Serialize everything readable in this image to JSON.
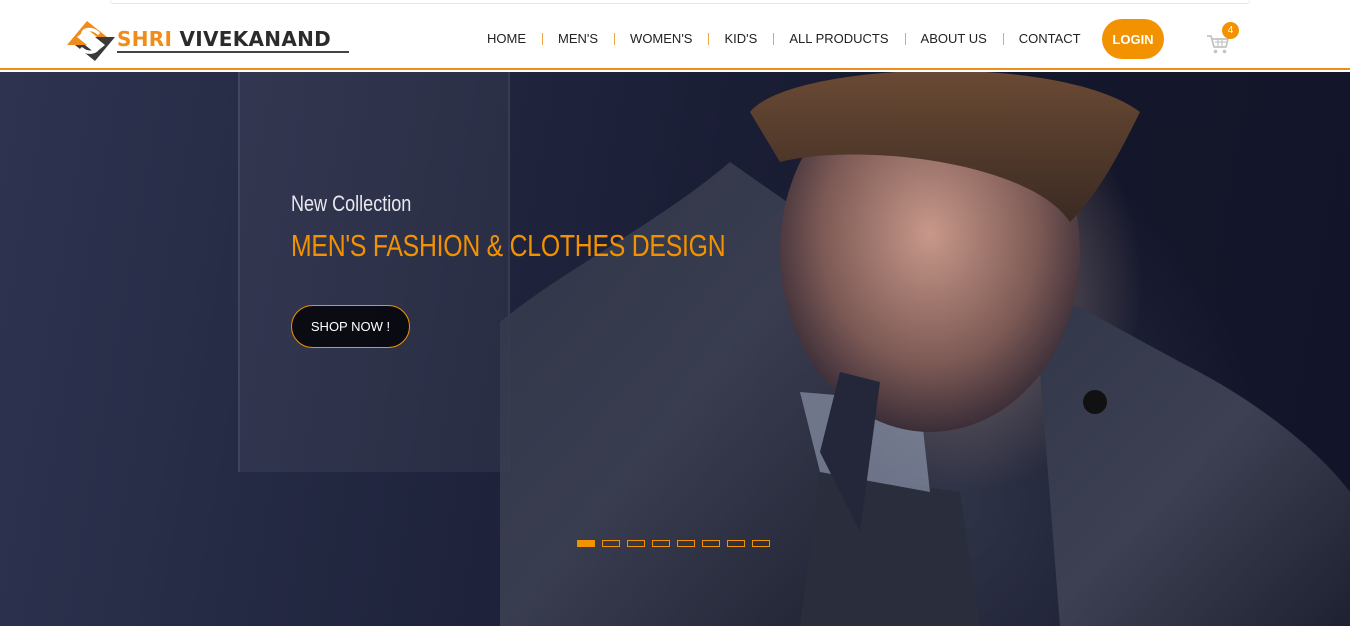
{
  "brand": {
    "word1": "SHRI",
    "word2": "VIVEKANAND",
    "accent_color": "#f39200",
    "dark_color": "#2b2b2b"
  },
  "nav": {
    "items": [
      {
        "label": "HOME"
      },
      {
        "label": "MEN'S"
      },
      {
        "label": "WOMEN'S"
      },
      {
        "label": "KID'S"
      },
      {
        "label": "ALL PRODUCTS"
      },
      {
        "label": "ABOUT US"
      },
      {
        "label": "CONTACT"
      }
    ]
  },
  "header": {
    "login_label": "LOGIN",
    "cart_icon": "cart-icon",
    "cart_count": "4"
  },
  "hero": {
    "subtitle": "New Collection",
    "title": "MEN'S FASHION & CLOTHES DESIGN",
    "cta_label": "SHOP NOW !",
    "slides_total": 8,
    "active_slide": 1
  }
}
